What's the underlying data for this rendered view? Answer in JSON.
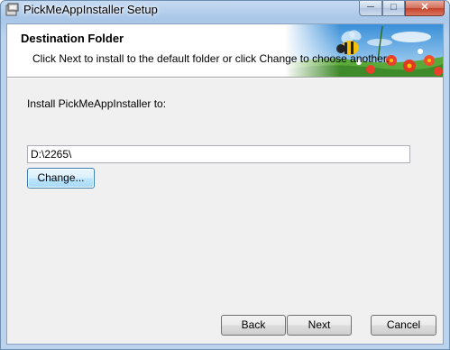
{
  "window": {
    "title": "PickMeAppInstaller Setup",
    "minimize_glyph": "─",
    "maximize_glyph": "□",
    "close_glyph": "✕"
  },
  "banner": {
    "title": "Destination Folder",
    "description": "Click Next to install to the default folder or click Change to choose another."
  },
  "main": {
    "install_label": "Install PickMeAppInstaller to:",
    "path_value": "D:\\2265\\",
    "change_label": "Change..."
  },
  "footer": {
    "back_label": "Back",
    "next_label": "Next",
    "cancel_label": "Cancel"
  },
  "icons": [
    "installer-app-icon",
    "bee-flowers-banner-art"
  ]
}
